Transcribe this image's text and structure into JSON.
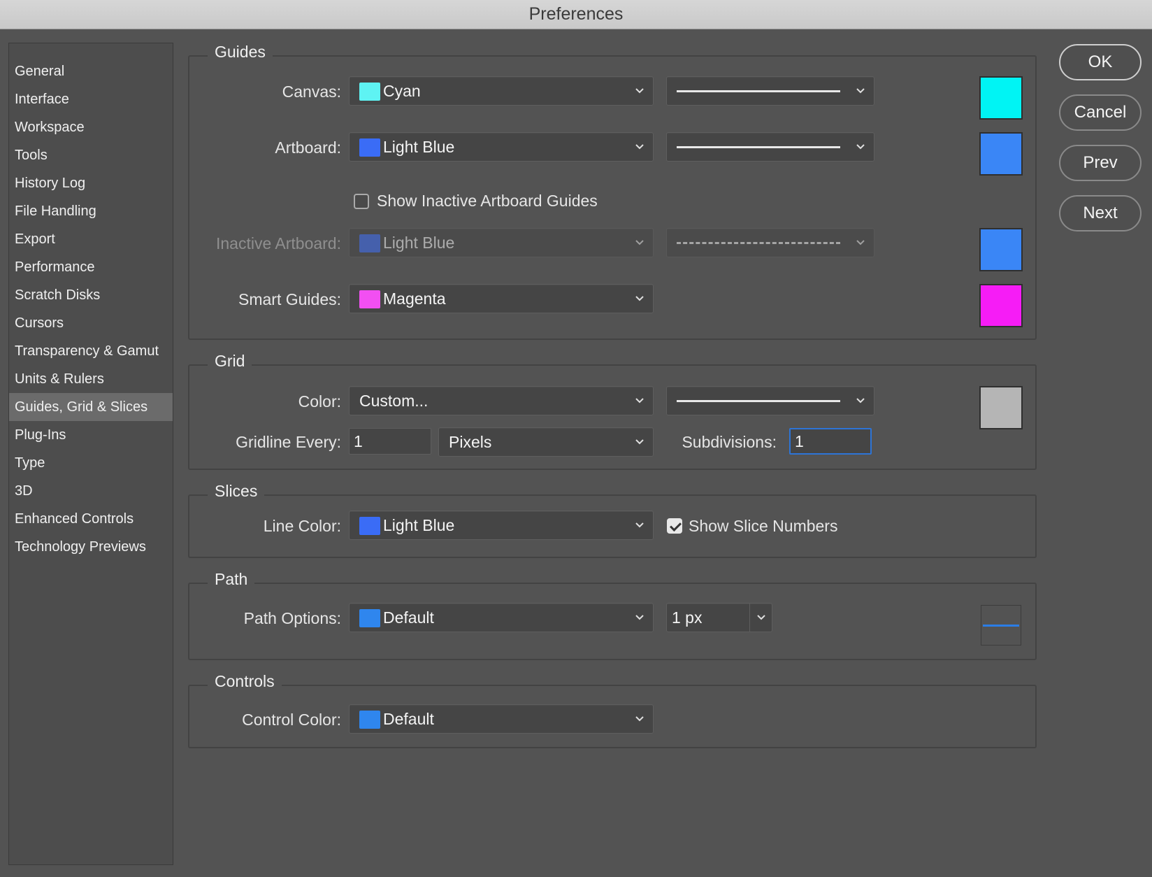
{
  "window": {
    "title": "Preferences"
  },
  "sidebar": {
    "items": [
      {
        "label": "General"
      },
      {
        "label": "Interface"
      },
      {
        "label": "Workspace"
      },
      {
        "label": "Tools"
      },
      {
        "label": "History Log"
      },
      {
        "label": "File Handling"
      },
      {
        "label": "Export"
      },
      {
        "label": "Performance"
      },
      {
        "label": "Scratch Disks"
      },
      {
        "label": "Cursors"
      },
      {
        "label": "Transparency & Gamut"
      },
      {
        "label": "Units & Rulers"
      },
      {
        "label": "Guides, Grid & Slices",
        "selected": true
      },
      {
        "label": "Plug-Ins"
      },
      {
        "label": "Type"
      },
      {
        "label": "3D"
      },
      {
        "label": "Enhanced Controls"
      },
      {
        "label": "Technology Previews"
      }
    ]
  },
  "guides": {
    "title": "Guides",
    "canvas": {
      "label": "Canvas:",
      "color_name": "Cyan",
      "color": "#5ef3f3",
      "swatch": "#00f4f4",
      "line_style": "solid"
    },
    "artboard": {
      "label": "Artboard:",
      "color_name": "Light Blue",
      "color": "#3a6cf6",
      "swatch": "#3a86f6",
      "line_style": "solid"
    },
    "show_inactive": {
      "label": "Show Inactive Artboard Guides",
      "checked": false
    },
    "inactive_artboard": {
      "label": "Inactive Artboard:",
      "color_name": "Light Blue",
      "color": "#3a6cf6",
      "swatch": "#3a86f6",
      "line_style": "dashed",
      "disabled": true
    },
    "smart_guides": {
      "label": "Smart Guides:",
      "color_name": "Magenta",
      "color": "#f24ff2",
      "swatch": "#f61cf6"
    }
  },
  "grid": {
    "title": "Grid",
    "color": {
      "label": "Color:",
      "value": "Custom...",
      "swatch": "#b5b5b5",
      "line_style": "solid"
    },
    "gridline": {
      "label": "Gridline Every:",
      "value": "1",
      "unit": "Pixels"
    },
    "subdivisions": {
      "label": "Subdivisions:",
      "value": "1"
    }
  },
  "slices": {
    "title": "Slices",
    "line_color": {
      "label": "Line Color:",
      "color_name": "Light Blue",
      "color": "#3a6cf6"
    },
    "show_numbers": {
      "label": "Show Slice Numbers",
      "checked": true
    }
  },
  "path": {
    "title": "Path",
    "options": {
      "label": "Path Options:",
      "color_name": "Default",
      "color": "#2f86ee",
      "size": "1 px",
      "preview_color": "#2b7de6"
    }
  },
  "controls": {
    "title": "Controls",
    "control_color": {
      "label": "Control Color:",
      "color_name": "Default",
      "color": "#2f86ee"
    }
  },
  "buttons": {
    "ok": "OK",
    "cancel": "Cancel",
    "prev": "Prev",
    "next": "Next"
  }
}
